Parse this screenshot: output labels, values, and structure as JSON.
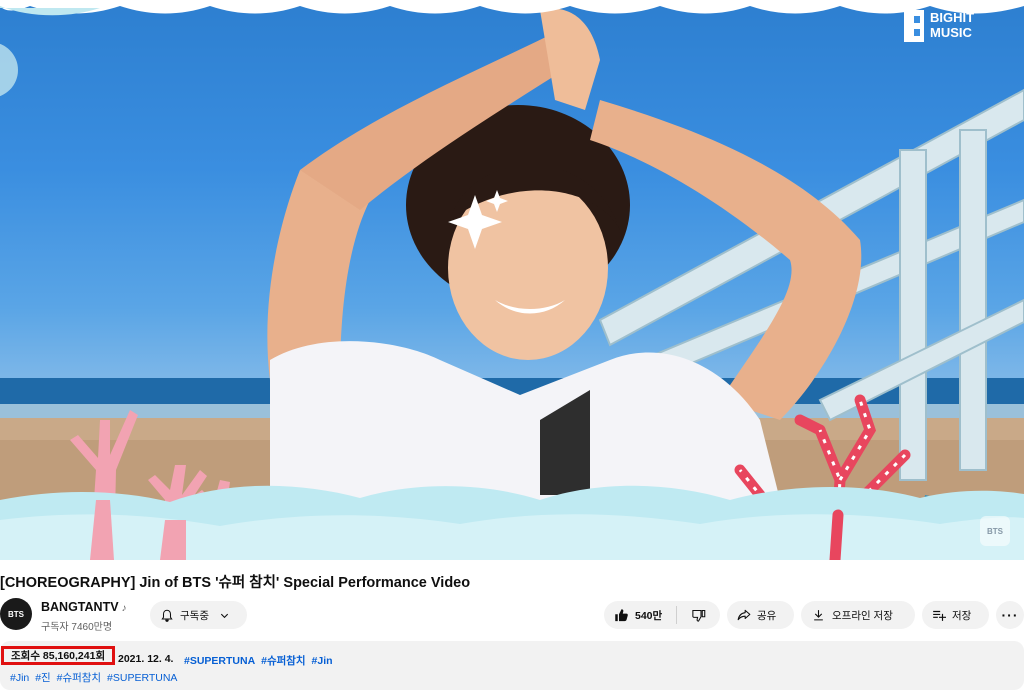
{
  "video": {
    "watermark_text": "BIGHIT\nMUSIC",
    "corner_badge": "BTS"
  },
  "title": "[CHOREOGRAPHY] Jin of BTS '슈퍼 참치' Special Performance Video",
  "channel": {
    "avatar_text": "BTS",
    "name": "BANGTANTV",
    "note_icon": "♪",
    "subscribers": "구독자 7460만명"
  },
  "actions": {
    "subscribe_label": "구독중",
    "like_count": "540만",
    "share_label": "공유",
    "download_label": "오프라인 저장",
    "save_label": "저장",
    "more_label": "···"
  },
  "description": {
    "views": "조회수 85,160,241회",
    "date": "2021. 12. 4.",
    "tags_line1": [
      "#SUPERTUNA",
      "#슈퍼참치",
      "#Jin"
    ],
    "tags_line2": [
      "#Jin",
      "#진",
      "#슈퍼참치",
      "#SUPERTUNA"
    ],
    "link_color": "#065fd4",
    "highlight_color": "#e01010"
  }
}
